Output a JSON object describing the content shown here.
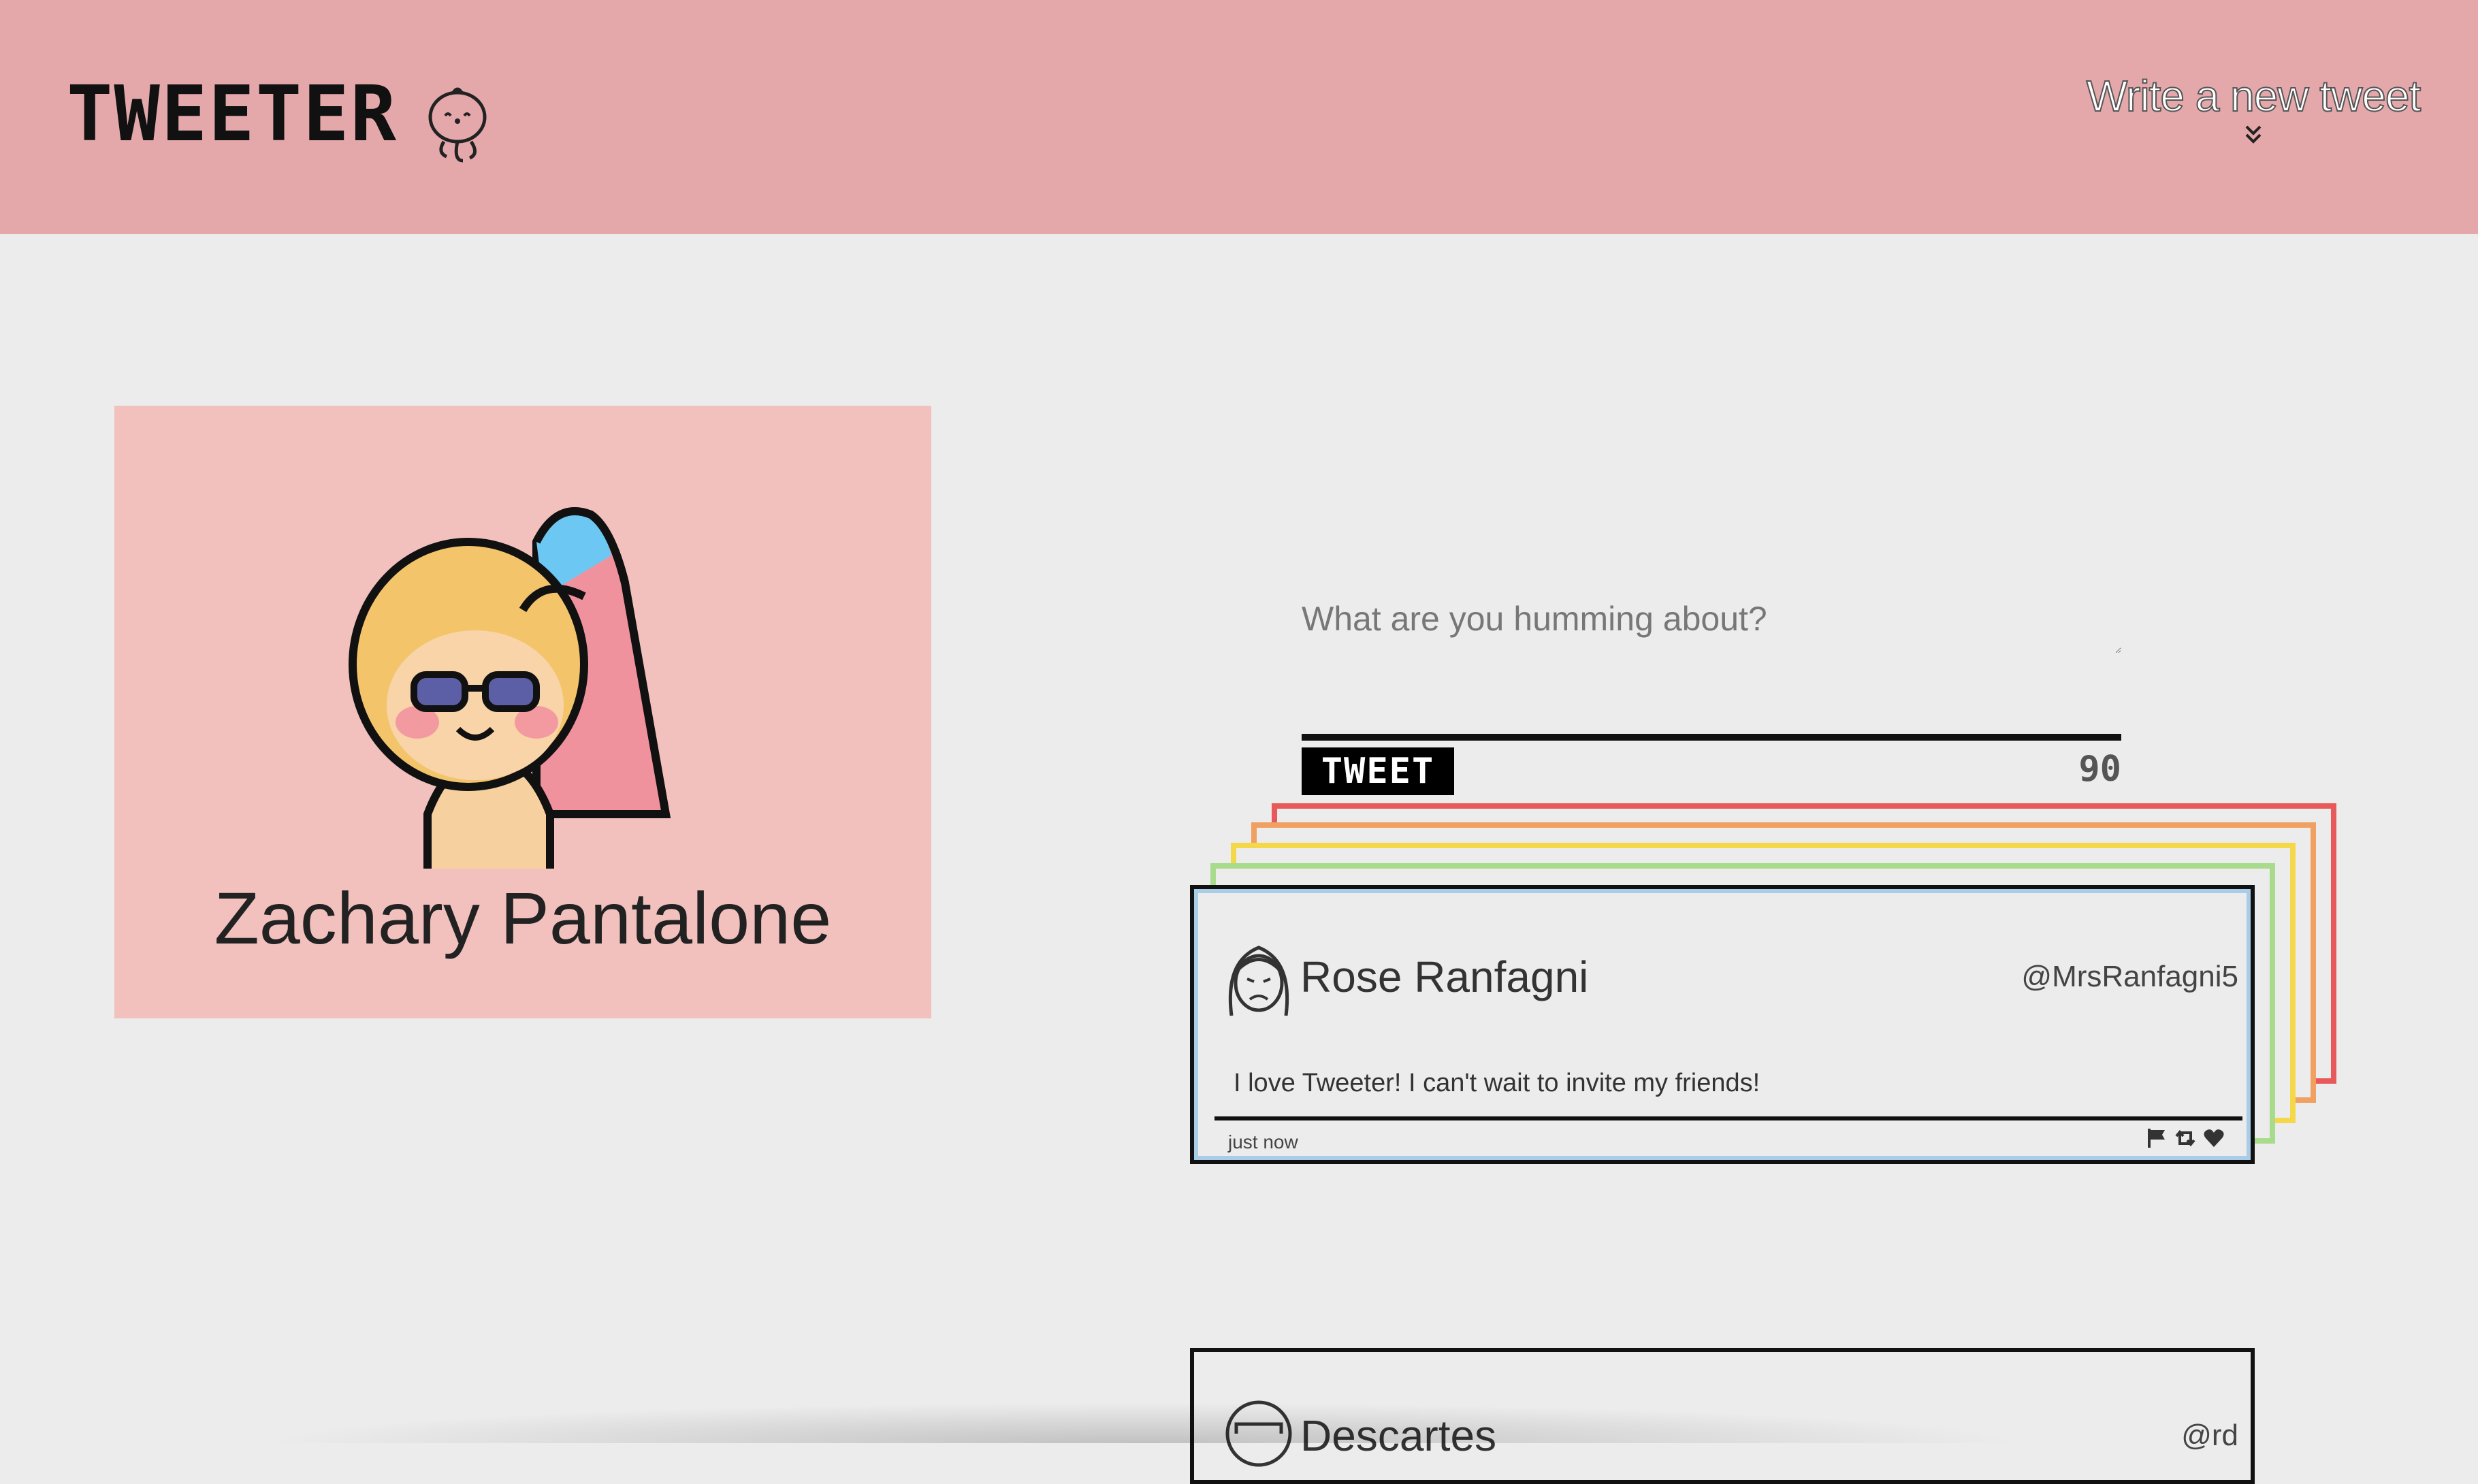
{
  "app": {
    "name": "TWEETER"
  },
  "nav": {
    "compose_label": "Write a new tweet",
    "compose_icon": "double-chevron-down-icon",
    "background": "#e4a8ab"
  },
  "profile": {
    "name": "Zachary Pantalone",
    "avatar_icon": "sunglasses-girl-avatar-icon",
    "card_color": "#f2c1be"
  },
  "composer": {
    "placeholder": "What are you humming about?",
    "submit_label": "TWEET",
    "char_count": "90"
  },
  "stack_colors": [
    "#e85a5a",
    "#f0a060",
    "#f5d84a",
    "#a8dc8c",
    "#a9cde6"
  ],
  "tweets": [
    {
      "author": "Rose Ranfagni",
      "handle": "@MrsRanfagni5",
      "body": "I love Tweeter! I can't wait to invite my friends!",
      "time": "just now",
      "avatar_icon": "frowning-woman-avatar-icon",
      "actions": [
        "flag-icon",
        "retweet-icon",
        "heart-icon"
      ]
    },
    {
      "author": "Descartes",
      "handle": "@rd",
      "avatar_icon": "bearded-man-avatar-icon"
    }
  ]
}
